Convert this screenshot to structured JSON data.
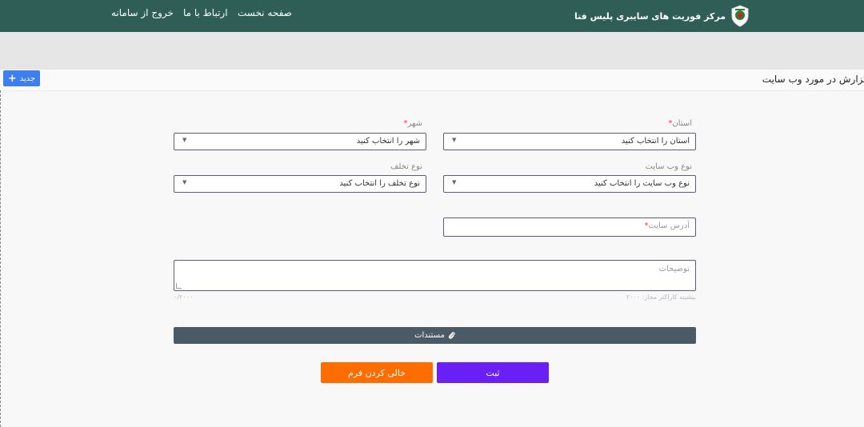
{
  "header": {
    "brand_title": "مرکز فوریت های سایبری پلیس فتا",
    "nav": {
      "home": "صفحه نخست",
      "contact": "ارتباط با ما",
      "logout": "خروج از سامانه"
    },
    "color": "#2e5e55"
  },
  "page": {
    "title": "گزارش در مورد وب سایت",
    "new_button": "جدید"
  },
  "form": {
    "province": {
      "label": "استان",
      "required_mark": "*",
      "value": "استان را انتخاب کنید"
    },
    "city": {
      "label": "شهر",
      "required_mark": "*",
      "value": "شهر را انتخاب کنید"
    },
    "site_type": {
      "label": "نوع وب سایت",
      "value": "نوع وب سایت را انتخاب کنید"
    },
    "violation_type": {
      "label": "نوع تخلف",
      "value": "نوع تخلف را انتخاب کنید"
    },
    "site_address": {
      "placeholder": "آدرس سایت",
      "required_mark": "*"
    },
    "description": {
      "placeholder": "توضیحات",
      "hint": "بیشینه کاراکتر مجاز: ۲۰۰۰",
      "counter": "۰/۲۰۰۰"
    },
    "documents_label": "مستندات",
    "submit_label": "ثبت",
    "clear_label": "خالی کردن فرم"
  },
  "colors": {
    "accent_blue": "#3d7ff0",
    "submit": "#6a1ff5",
    "clear": "#ff6d00",
    "docs_bar": "#4a5a66",
    "required": "#e53935"
  }
}
